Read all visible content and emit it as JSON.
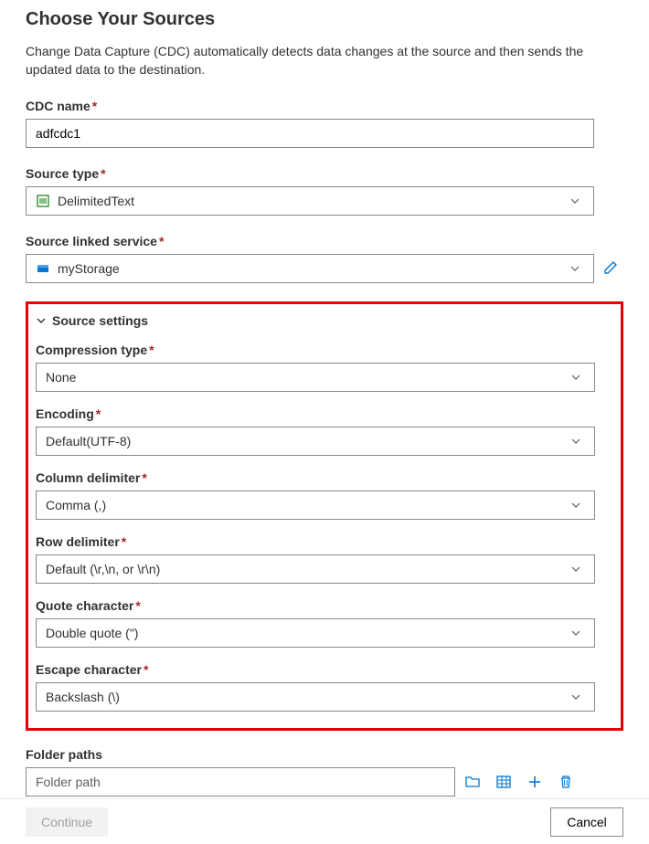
{
  "header": {
    "title": "Choose Your Sources",
    "description": "Change Data Capture (CDC) automatically detects data changes at the source and then sends the updated data to the destination."
  },
  "fields": {
    "cdc_name": {
      "label": "CDC name",
      "value": "adfcdc1"
    },
    "source_type": {
      "label": "Source type",
      "value": "DelimitedText"
    },
    "source_linked_service": {
      "label": "Source linked service",
      "value": "myStorage"
    }
  },
  "source_settings": {
    "title": "Source settings",
    "compression_type": {
      "label": "Compression type",
      "value": "None"
    },
    "encoding": {
      "label": "Encoding",
      "value": "Default(UTF-8)"
    },
    "column_delimiter": {
      "label": "Column delimiter",
      "value": "Comma (,)"
    },
    "row_delimiter": {
      "label": "Row delimiter",
      "value": "Default (\\r,\\n, or \\r\\n)"
    },
    "quote_character": {
      "label": "Quote character",
      "value": "Double quote (\")"
    },
    "escape_character": {
      "label": "Escape character",
      "value": "Backslash (\\)"
    }
  },
  "folder_paths": {
    "label": "Folder paths",
    "placeholder": "Folder path"
  },
  "footer": {
    "continue": "Continue",
    "cancel": "Cancel"
  }
}
